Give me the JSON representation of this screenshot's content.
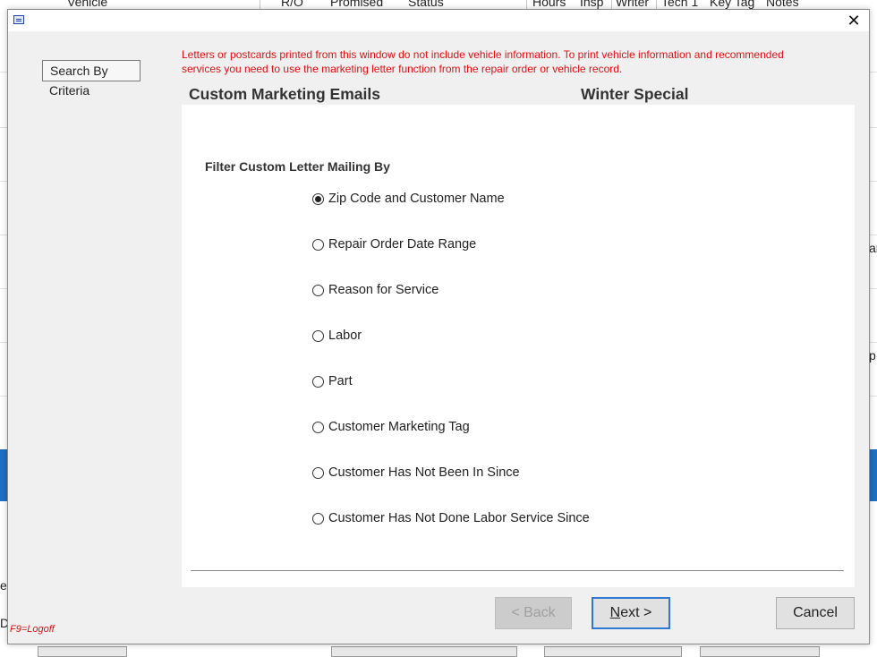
{
  "background": {
    "columns": [
      "Vehicle",
      "R/O",
      "Promised",
      "Status",
      "Hours",
      "Insp",
      "Writer",
      "Tech 1",
      "Key Tag",
      "Notes"
    ],
    "edge_fragments": [
      "ar",
      "p",
      "e",
      "D"
    ],
    "accent_color": "#1e6fc2"
  },
  "dialog": {
    "title": "",
    "close_icon": "close-icon",
    "left_panel": {
      "search_by_label": "Search By",
      "criteria_label": "Criteria"
    },
    "notice": "Letters or postcards printed from this window do not include vehicle information.  To print vehicle information and recommended services you need to use the marketing letter function from the repair order or vehicle record.",
    "heading_left": "Custom Marketing Emails",
    "heading_right": "Winter Special",
    "filter_title": "Filter Custom Letter Mailing By",
    "options": [
      {
        "label": "Zip Code and Customer Name",
        "selected": true
      },
      {
        "label": "Repair Order Date Range",
        "selected": false
      },
      {
        "label": "Reason for Service",
        "selected": false
      },
      {
        "label": "Labor",
        "selected": false
      },
      {
        "label": "Part",
        "selected": false
      },
      {
        "label": "Customer Marketing Tag",
        "selected": false
      },
      {
        "label": "Customer Has Not Been In Since",
        "selected": false
      },
      {
        "label": "Customer Has Not Done Labor Service Since",
        "selected": false
      }
    ],
    "buttons": {
      "back": "< Back",
      "next_underlined": "N",
      "next_rest": "ext >",
      "cancel": "Cancel"
    },
    "footer_hint": "F9=Logoff",
    "colors": {
      "notice": "#e01010",
      "primary_border": "#2f7ad0"
    }
  }
}
